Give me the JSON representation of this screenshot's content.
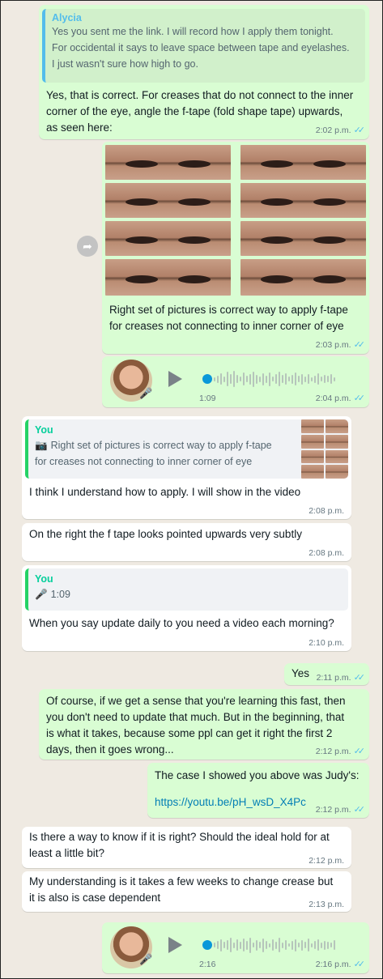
{
  "messages": [
    {
      "quote_name": "Alycia",
      "quote_text": [
        "Yes you sent me the link. I will record how I apply them tonight.",
        "For occidental it says to leave space between tape and eyelashes.",
        "I just wasn't sure how high to go."
      ],
      "text": [
        "Yes, that is correct. For creases that do not connect to the inner",
        "corner of the eye, angle the f-tape (fold shape tape) upwards,",
        "as seen here:"
      ],
      "time": "2:02 p.m.",
      "ticks": "✓✓"
    },
    {
      "caption": [
        "Right set of pictures is correct way to apply f-tape",
        "for creases not connecting to inner corner of eye"
      ],
      "time": "2:03 p.m.",
      "ticks": "✓✓"
    },
    {
      "duration": "1:09",
      "time": "2:04 p.m.",
      "ticks": "✓✓"
    },
    {
      "quote_name": "You",
      "quote_icon": "camera-icon",
      "quote_text": [
        "Right set of pictures is correct way to apply f-tape",
        "for creases not connecting to inner corner of eye"
      ],
      "text": [
        "I think I understand how to apply. I will show in the video"
      ],
      "time": "2:08 p.m."
    },
    {
      "text": [
        "On the right the f tape looks pointed upwards very subtly"
      ],
      "time": "2:08 p.m."
    },
    {
      "quote_name": "You",
      "quote_duration": "1:09",
      "text": [
        "When you say update daily to you need a video each morning?"
      ],
      "time": "2:10 p.m."
    },
    {
      "text": [
        "Yes"
      ],
      "time": "2:11 p.m.",
      "ticks": "✓✓"
    },
    {
      "text": [
        "Of course, if we get a sense that you're learning this fast, then",
        "you don't need to update that much. But in the beginning, that",
        "is what it takes, because some ppl can get it right the first 2",
        "days, then it goes wrong..."
      ],
      "time": "2:12 p.m.",
      "ticks": "✓✓"
    },
    {
      "text": [
        "The case I showed you above was Judy's:"
      ],
      "link": "https://youtu.be/pH_wsD_X4Pc",
      "time": "2:12 p.m.",
      "ticks": "✓✓"
    },
    {
      "text": [
        "Is there a way to know if it is right? Should the ideal hold for at",
        "least a little bit?"
      ],
      "time": "2:12 p.m."
    },
    {
      "text": [
        "My understanding is it takes a few weeks to change crease but",
        "it is also is case dependent"
      ],
      "time": "2:13 p.m."
    },
    {
      "duration": "2:16",
      "time": "2:16 p.m.",
      "ticks": "✓✓"
    }
  ]
}
